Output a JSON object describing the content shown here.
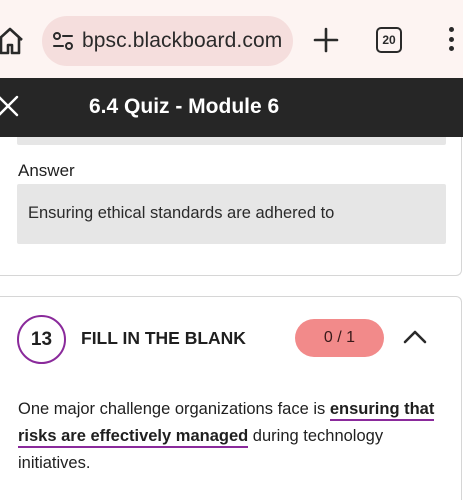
{
  "browser": {
    "url": "bpsc.blackboard.com",
    "tab_count": "20",
    "icons": {
      "home": "home-icon",
      "site_info": "tune-icon",
      "new_tab": "plus-icon",
      "menu": "more-vertical-icon"
    }
  },
  "quiz": {
    "title": "6.4 Quiz - Module 6",
    "close_icon": "close-icon"
  },
  "previous_question": {
    "answer_label": "Answer",
    "answer_text": "Ensuring ethical standards are adhered to"
  },
  "question": {
    "number": "13",
    "type": "FILL IN THE BLANK",
    "score": "0 / 1",
    "collapse_icon": "chevron-up-icon",
    "text_before": "One major challenge organizations face is ",
    "blank_answer": "ensuring that risks are effectively managed",
    "text_after": " during technology initiatives."
  },
  "colors": {
    "accent_purple": "#8a2a9b",
    "score_badge": "#f28a8a",
    "header_bg": "#262626",
    "browser_bg": "#fdf4f2",
    "url_pill": "#f5dedd",
    "answer_box": "#e6e6e6"
  }
}
